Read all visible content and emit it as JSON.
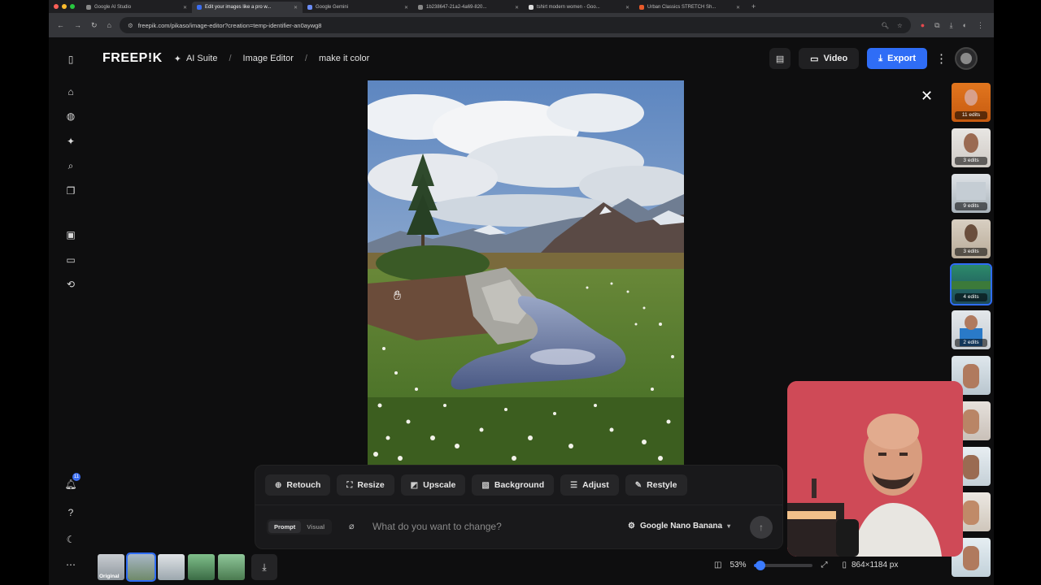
{
  "browser": {
    "tabs": [
      {
        "title": "Google AI Studio",
        "active": false
      },
      {
        "title": "Edit your images like a pro w...",
        "active": true
      },
      {
        "title": "Google Gemini",
        "active": false
      },
      {
        "title": "1b238647-21a2-4a69-820...",
        "active": false
      },
      {
        "title": "tshirt modern women - Goo...",
        "active": false
      },
      {
        "title": "Urban Classics STRETCH Sh...",
        "active": false
      }
    ],
    "url": "freepik.com/pikaso/image-editor?creation=temp-identifier-an0aywg8"
  },
  "header": {
    "logo": "FREEP!K",
    "breadcrumbs": [
      "AI Suite",
      "Image Editor",
      "make it color"
    ],
    "video_label": "Video",
    "export_label": "Export"
  },
  "sidebar": {
    "notification_count": "11"
  },
  "history": [
    {
      "label": "11 edits",
      "selected": false
    },
    {
      "label": "3 edits",
      "selected": false
    },
    {
      "label": "9 edits",
      "selected": false
    },
    {
      "label": "3 edits",
      "selected": false
    },
    {
      "label": "4 edits",
      "selected": true
    },
    {
      "label": "2 edits",
      "selected": false
    }
  ],
  "tools": [
    "Retouch",
    "Resize",
    "Upscale",
    "Background",
    "Adjust",
    "Restyle"
  ],
  "prompt": {
    "modes": [
      "Prompt",
      "Visual"
    ],
    "placeholder": "What do you want to change?",
    "model": "Google Nano Banana"
  },
  "bottom": {
    "original_label": "Original",
    "zoom": "53%",
    "zoom_fraction": 0.1,
    "dimensions": "864×1184 px"
  },
  "colors": {
    "accent": "#2f6df6",
    "background": "#0e0e0f"
  }
}
